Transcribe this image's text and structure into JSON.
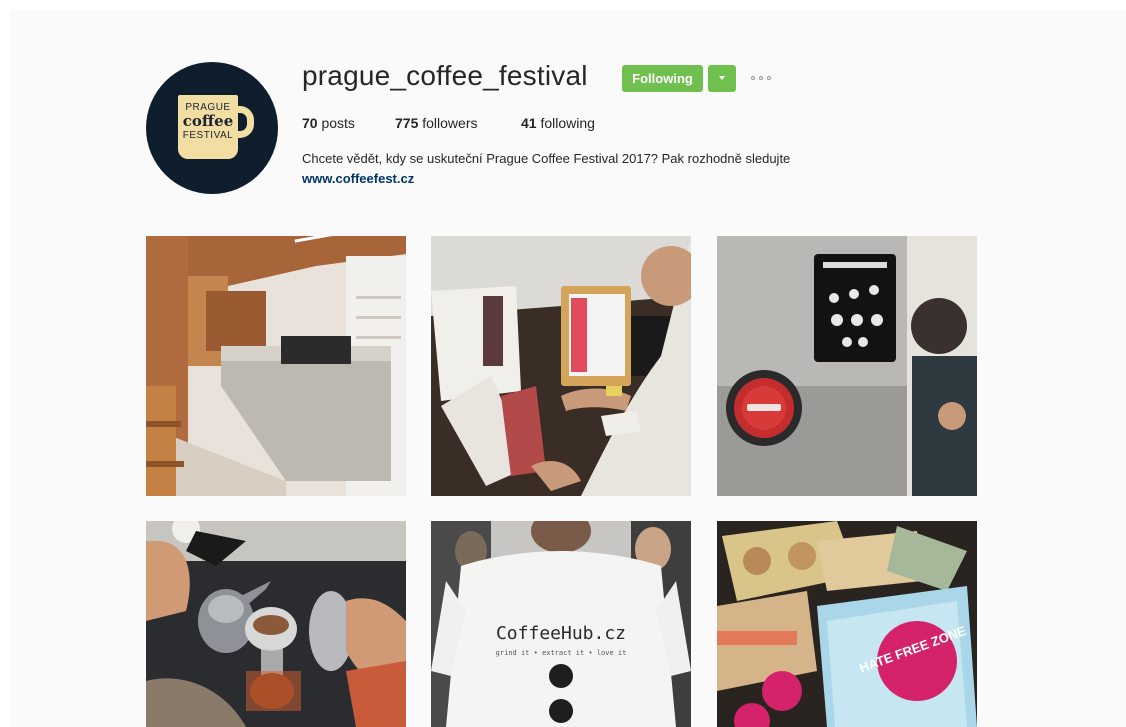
{
  "profile": {
    "username": "prague_coffee_festival",
    "follow_button_label": "Following",
    "stats": {
      "posts_count": "70",
      "posts_label": "posts",
      "followers_count": "775",
      "followers_label": "followers",
      "following_count": "41",
      "following_label": "following"
    },
    "bio": "Chcete vědět, kdy se uskuteční Prague Coffee Festival 2017? Pak rozhodně sledujte",
    "website": "www.coffeefest.cz",
    "logo": {
      "line1": "PRAGUE",
      "line2": "coffee",
      "line3": "FESTIVAL"
    }
  },
  "posts": [
    {
      "subject": "cafe-interior"
    },
    {
      "subject": "tablet-pos-with-menus"
    },
    {
      "subject": "grinder-with-sticker"
    },
    {
      "subject": "pour-over-brewing"
    },
    {
      "subject": "coffeehub-tshirt",
      "tshirt_text": "CoffeeHub.cz",
      "tshirt_tagline": "grind it • extract it • love it"
    },
    {
      "subject": "stickers-and-postcards",
      "sticker_text": "HATE FREE ZONE"
    }
  ],
  "colors": {
    "follow_green": "#70c050",
    "link_blue": "#003569",
    "avatar_bg": "#0f1e2c",
    "logo_cream": "#f2dda2"
  }
}
